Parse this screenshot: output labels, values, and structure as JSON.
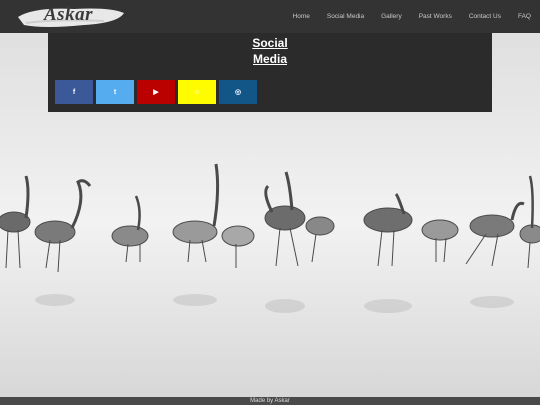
{
  "brand": {
    "logo_text": "Askar"
  },
  "nav": {
    "items": [
      {
        "label": "Home"
      },
      {
        "label": "Social Media"
      },
      {
        "label": "Gallery"
      },
      {
        "label": "Past Works"
      },
      {
        "label": "Contact Us"
      },
      {
        "label": "FAQ"
      }
    ]
  },
  "panel": {
    "title_line1": "Social",
    "title_line2": "Media"
  },
  "socials": [
    {
      "icon": "facebook-icon",
      "glyph": "f",
      "color": "#3b5998"
    },
    {
      "icon": "twitter-icon",
      "glyph": "t",
      "color": "#55acee"
    },
    {
      "icon": "youtube-icon",
      "glyph": "▶",
      "color": "#bb0000"
    },
    {
      "icon": "snapchat-icon",
      "glyph": "☺",
      "color": "#fffc00"
    },
    {
      "icon": "instagram-icon",
      "glyph": "◎",
      "color": "#125688"
    }
  ],
  "footer": {
    "text": "Made by Askar"
  }
}
